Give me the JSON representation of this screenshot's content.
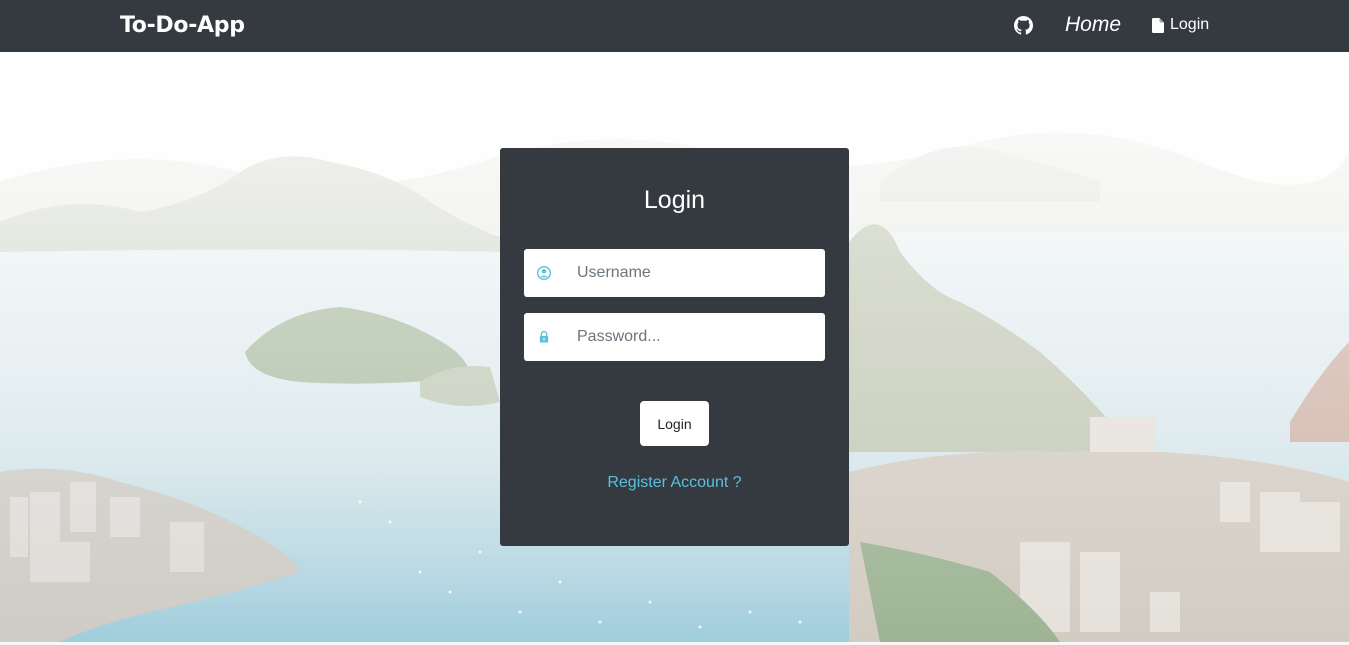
{
  "navbar": {
    "brand": "To-Do-App",
    "github_icon": "github-icon",
    "home_label": "Home",
    "login_label": "Login",
    "login_icon": "file-icon",
    "background": "#343a40"
  },
  "login_card": {
    "title": "Login",
    "username": {
      "icon": "user-circle-icon",
      "placeholder": "Username",
      "value": ""
    },
    "password": {
      "icon": "lock-icon",
      "placeholder": "Password...",
      "value": ""
    },
    "submit_label": "Login",
    "register_link": "Register Account ?",
    "accent_color": "#5bc0de"
  },
  "background_image": "coastal-city-photo"
}
